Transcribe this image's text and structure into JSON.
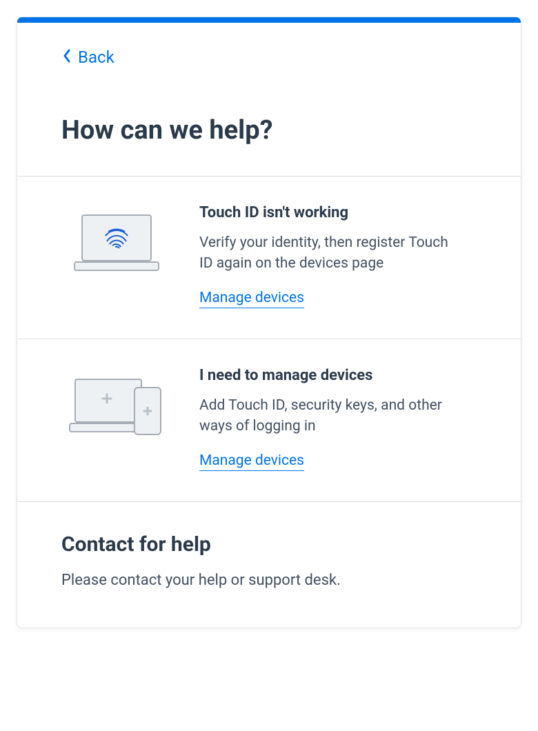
{
  "accent_color": "#0073e7",
  "back": {
    "label": "Back"
  },
  "title": "How can we help?",
  "options": [
    {
      "title": "Touch ID isn't working",
      "description": "Verify your identity, then register Touch ID again on the devices page",
      "link_label": "Manage devices"
    },
    {
      "title": "I need to manage devices",
      "description": "Add Touch ID, security keys, and other ways of logging in",
      "link_label": "Manage devices"
    }
  ],
  "contact": {
    "title": "Contact for help",
    "description": "Please contact your help or support desk."
  }
}
